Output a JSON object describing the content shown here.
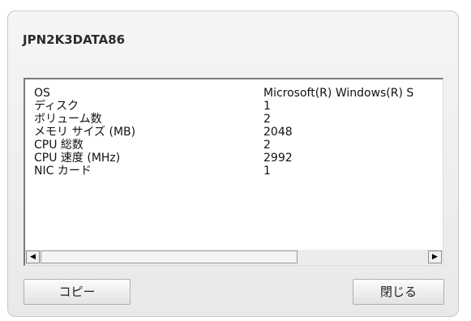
{
  "dialog": {
    "title": "JPN2K3DATA86"
  },
  "properties": [
    {
      "key": "OS",
      "value": "Microsoft(R) Windows(R) S"
    },
    {
      "key": "ディスク",
      "value": "1"
    },
    {
      "key": "ボリューム数",
      "value": "2"
    },
    {
      "key": "メモリ サイズ (MB)",
      "value": "2048"
    },
    {
      "key": "CPU 総数",
      "value": "2"
    },
    {
      "key": "CPU 速度 (MHz)",
      "value": "2992"
    },
    {
      "key": "NIC カード",
      "value": "1"
    }
  ],
  "scrollbar": {
    "left_arrow_icon": "◀",
    "right_arrow_icon": "▶"
  },
  "buttons": {
    "copy_label": "コピー",
    "close_label": "閉じる"
  }
}
